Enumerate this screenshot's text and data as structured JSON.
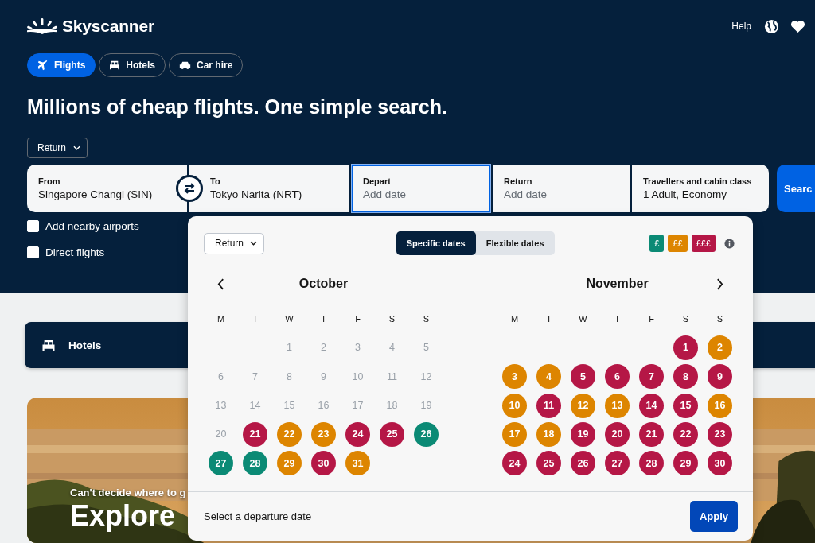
{
  "brand": "Skyscanner",
  "header_links": [
    {
      "kind": "text",
      "label": "Help"
    },
    {
      "kind": "globe"
    },
    {
      "kind": "heart"
    }
  ],
  "tabs": [
    {
      "label": "Flights",
      "selected": true
    },
    {
      "label": "Hotels",
      "selected": false
    },
    {
      "label": "Car hire",
      "selected": false
    }
  ],
  "headline": "Millions of cheap flights. One simple search.",
  "trip_type": "Return",
  "search_fields": [
    {
      "label": "From",
      "value": "Singapore Changi (SIN)",
      "selected": false
    },
    {
      "label": "To",
      "value": "Tokyo Narita (NRT)",
      "selected": false
    },
    {
      "label": "Depart",
      "placeholder": "Add date",
      "selected": true
    },
    {
      "label": "Return",
      "placeholder": "Add date",
      "selected": false
    },
    {
      "label": "Travellers and cabin class",
      "value": "1 Adult, Economy",
      "selected": false
    }
  ],
  "search_button": "Searc",
  "options": [
    {
      "label": "Add nearby airports",
      "checked": false
    },
    {
      "label": "Direct flights",
      "checked": false
    }
  ],
  "hotels_bar": "Hotels",
  "hero": {
    "kind": "picture",
    "subtitle": "Can't decide where to g",
    "title": "Explore"
  },
  "calendar": {
    "trip_type": "Return",
    "modes": [
      {
        "label": "Specific dates",
        "selected": true
      },
      {
        "label": "Flexible dates",
        "selected": false
      }
    ],
    "price_legend": [
      {
        "label": "£",
        "color": "#0b8a75"
      },
      {
        "label": "££",
        "color": "#dd8500"
      },
      {
        "label": "£££",
        "color": "#b51746"
      }
    ],
    "months": [
      {
        "name": "October",
        "weekdays": [
          "M",
          "T",
          "W",
          "T",
          "F",
          "S",
          "S"
        ],
        "days": [
          {
            "kind": "blank"
          },
          {
            "kind": "blank"
          },
          {
            "kind": "day",
            "label": "1",
            "disabled": true
          },
          {
            "kind": "day",
            "label": "2",
            "disabled": true
          },
          {
            "kind": "day",
            "label": "3",
            "disabled": true
          },
          {
            "kind": "day",
            "label": "4",
            "disabled": true
          },
          {
            "kind": "day",
            "label": "5",
            "disabled": true
          },
          {
            "kind": "day",
            "label": "6",
            "disabled": true
          },
          {
            "kind": "day",
            "label": "7",
            "disabled": true
          },
          {
            "kind": "day",
            "label": "8",
            "disabled": true
          },
          {
            "kind": "day",
            "label": "9",
            "disabled": true
          },
          {
            "kind": "day",
            "label": "10",
            "disabled": true
          },
          {
            "kind": "day",
            "label": "11",
            "disabled": true
          },
          {
            "kind": "day",
            "label": "12",
            "disabled": true
          },
          {
            "kind": "day",
            "label": "13",
            "disabled": true
          },
          {
            "kind": "day",
            "label": "14",
            "disabled": true
          },
          {
            "kind": "day",
            "label": "15",
            "disabled": true
          },
          {
            "kind": "day",
            "label": "16",
            "disabled": true
          },
          {
            "kind": "day",
            "label": "17",
            "disabled": true
          },
          {
            "kind": "day",
            "label": "18",
            "disabled": true
          },
          {
            "kind": "day",
            "label": "19",
            "disabled": true
          },
          {
            "kind": "day",
            "label": "20",
            "disabled": true
          },
          {
            "kind": "day",
            "label": "21",
            "disabled": false,
            "color": "#b51746"
          },
          {
            "kind": "day",
            "label": "22",
            "disabled": false,
            "color": "#dd8500"
          },
          {
            "kind": "day",
            "label": "23",
            "disabled": false,
            "color": "#dd8500"
          },
          {
            "kind": "day",
            "label": "24",
            "disabled": false,
            "color": "#b51746"
          },
          {
            "kind": "day",
            "label": "25",
            "disabled": false,
            "color": "#b51746"
          },
          {
            "kind": "day",
            "label": "26",
            "disabled": false,
            "color": "#0b8a75"
          },
          {
            "kind": "day",
            "label": "27",
            "disabled": false,
            "color": "#0b8a75"
          },
          {
            "kind": "day",
            "label": "28",
            "disabled": false,
            "color": "#0b8a75"
          },
          {
            "kind": "day",
            "label": "29",
            "disabled": false,
            "color": "#dd8500"
          },
          {
            "kind": "day",
            "label": "30",
            "disabled": false,
            "color": "#b51746"
          },
          {
            "kind": "day",
            "label": "31",
            "disabled": false,
            "color": "#dd8500"
          }
        ]
      },
      {
        "name": "November",
        "weekdays": [
          "M",
          "T",
          "W",
          "T",
          "F",
          "S",
          "S"
        ],
        "days": [
          {
            "kind": "blank"
          },
          {
            "kind": "blank"
          },
          {
            "kind": "blank"
          },
          {
            "kind": "blank"
          },
          {
            "kind": "blank"
          },
          {
            "kind": "day",
            "label": "1",
            "disabled": false,
            "color": "#b51746"
          },
          {
            "kind": "day",
            "label": "2",
            "disabled": false,
            "color": "#dd8500"
          },
          {
            "kind": "day",
            "label": "3",
            "disabled": false,
            "color": "#dd8500"
          },
          {
            "kind": "day",
            "label": "4",
            "disabled": false,
            "color": "#dd8500"
          },
          {
            "kind": "day",
            "label": "5",
            "disabled": false,
            "color": "#b51746"
          },
          {
            "kind": "day",
            "label": "6",
            "disabled": false,
            "color": "#b51746"
          },
          {
            "kind": "day",
            "label": "7",
            "disabled": false,
            "color": "#b51746"
          },
          {
            "kind": "day",
            "label": "8",
            "disabled": false,
            "color": "#b51746"
          },
          {
            "kind": "day",
            "label": "9",
            "disabled": false,
            "color": "#b51746"
          },
          {
            "kind": "day",
            "label": "10",
            "disabled": false,
            "color": "#dd8500"
          },
          {
            "kind": "day",
            "label": "11",
            "disabled": false,
            "color": "#b51746"
          },
          {
            "kind": "day",
            "label": "12",
            "disabled": false,
            "color": "#dd8500"
          },
          {
            "kind": "day",
            "label": "13",
            "disabled": false,
            "color": "#dd8500"
          },
          {
            "kind": "day",
            "label": "14",
            "disabled": false,
            "color": "#b51746"
          },
          {
            "kind": "day",
            "label": "15",
            "disabled": false,
            "color": "#b51746"
          },
          {
            "kind": "day",
            "label": "16",
            "disabled": false,
            "color": "#dd8500"
          },
          {
            "kind": "day",
            "label": "17",
            "disabled": false,
            "color": "#dd8500"
          },
          {
            "kind": "day",
            "label": "18",
            "disabled": false,
            "color": "#dd8500"
          },
          {
            "kind": "day",
            "label": "19",
            "disabled": false,
            "color": "#b51746"
          },
          {
            "kind": "day",
            "label": "20",
            "disabled": false,
            "color": "#b51746"
          },
          {
            "kind": "day",
            "label": "21",
            "disabled": false,
            "color": "#b51746"
          },
          {
            "kind": "day",
            "label": "22",
            "disabled": false,
            "color": "#b51746"
          },
          {
            "kind": "day",
            "label": "23",
            "disabled": false,
            "color": "#b51746"
          },
          {
            "kind": "day",
            "label": "24",
            "disabled": false,
            "color": "#b51746"
          },
          {
            "kind": "day",
            "label": "25",
            "disabled": false,
            "color": "#b51746"
          },
          {
            "kind": "day",
            "label": "26",
            "disabled": false,
            "color": "#b51746"
          },
          {
            "kind": "day",
            "label": "27",
            "disabled": false,
            "color": "#b51746"
          },
          {
            "kind": "day",
            "label": "28",
            "disabled": false,
            "color": "#b51746"
          },
          {
            "kind": "day",
            "label": "29",
            "disabled": false,
            "color": "#b51746"
          },
          {
            "kind": "day",
            "label": "30",
            "disabled": false,
            "color": "#b51746"
          }
        ]
      }
    ],
    "footer_text": "Select a departure date",
    "apply_button": "Apply"
  }
}
